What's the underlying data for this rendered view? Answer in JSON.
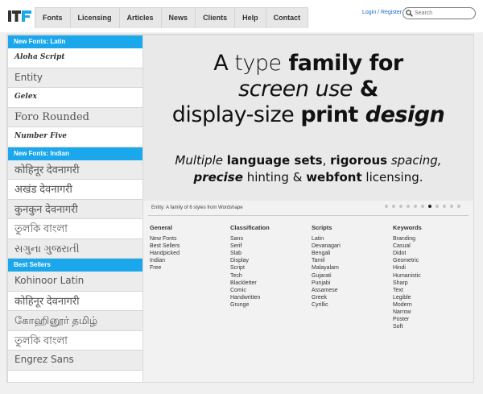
{
  "header": {
    "logo_text": "ITF",
    "nav": [
      "Fonts",
      "Licensing",
      "Articles",
      "News",
      "Clients",
      "Help",
      "Contact"
    ],
    "login": "Login / Register",
    "search_placeholder": "Search"
  },
  "sidebar": {
    "sections": [
      {
        "title": "New Fonts: Latin",
        "items": [
          "Aloha Script",
          "Entity",
          "Gelex",
          "Foro Rounded",
          "Number Five"
        ]
      },
      {
        "title": "New Fonts: Indian",
        "items": [
          "कोहिनूर देवनागरी",
          "अखंड देवनागरी",
          "कुनकुन देवनागरी",
          "তুলকি বাংলা",
          "સગુના ગુજરાતી"
        ]
      },
      {
        "title": "Best Sellers",
        "items": [
          "Kohinoor Latin",
          "कोहिनूर देवनागरी",
          "கோஹினூர் தமிழ்",
          "তুলকি বাংলা",
          "Engrez Sans"
        ]
      }
    ]
  },
  "hero": {
    "line1": [
      "A ",
      "type",
      " family for"
    ],
    "line2": [
      "screen use",
      " &"
    ],
    "line3": [
      "display-size ",
      "print",
      " design"
    ],
    "sub1": [
      "Multiple ",
      "language sets",
      ", ",
      "rigorous",
      " spacing,"
    ],
    "sub2": [
      "precise",
      " hinting & ",
      "webfont",
      " licensing."
    ],
    "caption": "Entity: A family of 6 styles from Wordshape",
    "dots_total": 11,
    "dots_active_index": 6
  },
  "categories": [
    {
      "title": "General",
      "items": [
        "New Fonts",
        "Best Sellers",
        "Handpicked",
        "Indian",
        "Free"
      ]
    },
    {
      "title": "Classification",
      "items": [
        "Sans",
        "Serif",
        "Slab",
        "Display",
        "Script",
        "Tech",
        "Blackletter",
        "Comic",
        "Handwritten",
        "Grunge"
      ]
    },
    {
      "title": "Scripts",
      "items": [
        "Latin",
        "Devanagari",
        "Bengali",
        "Tamil",
        "Malayalam",
        "Gujarati",
        "Punjabi",
        "Assamese",
        "Greek",
        "Cyrillic"
      ]
    },
    {
      "title": "Keywords",
      "items": [
        "Branding",
        "Casual",
        "Didot",
        "Geometric",
        "Hindi",
        "Humanistic",
        "Sharp",
        "Text",
        "Legible",
        "Modern",
        "Narrow",
        "Poster",
        "Soft"
      ]
    }
  ],
  "colors": {
    "accent": "#1aa7ec",
    "link": "#1a6ac9",
    "logo": "#1aa7ec"
  }
}
